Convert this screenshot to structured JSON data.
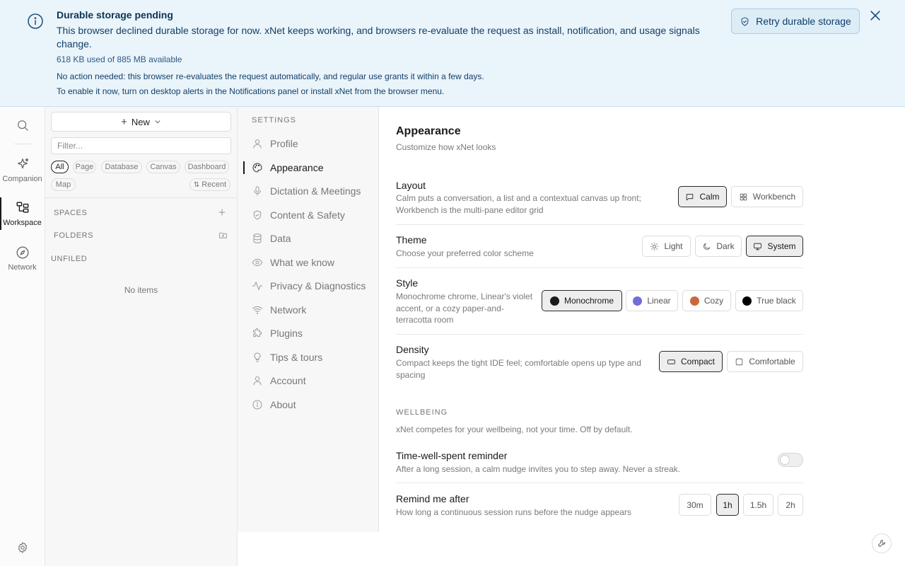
{
  "banner": {
    "title": "Durable storage pending",
    "body": "This browser declined durable storage for now. xNet keeps working, and browsers re-evaluate the request as install, notification, and usage signals change.",
    "usage": "618 KB used of 885 MB available",
    "note1": "No action needed: this browser re-evaluates the request automatically, and regular use grants it within a few days.",
    "note2": "To enable it now, turn on desktop alerts in the Notifications panel or install xNet from the browser menu.",
    "retry_label": "Retry durable storage",
    "icon": "info-icon"
  },
  "rail": {
    "items": [
      {
        "label": "Companion",
        "icon": "sparkle-icon"
      },
      {
        "label": "Workspace",
        "icon": "workspace-icon"
      },
      {
        "label": "Network",
        "icon": "compass-icon"
      }
    ]
  },
  "sidebar": {
    "new_label": "New",
    "filter_placeholder": "Filter...",
    "chips": [
      "All",
      "Page",
      "Database",
      "Canvas",
      "Dashboard",
      "Map"
    ],
    "active_chip": "All",
    "recent_label": "Recent",
    "spaces_label": "SPACES",
    "folders_label": "FOLDERS",
    "unfiled_label": "UNFILED",
    "empty_label": "No items"
  },
  "settings_nav": {
    "heading": "SETTINGS",
    "items": [
      {
        "label": "Profile",
        "icon": "user-icon"
      },
      {
        "label": "Appearance",
        "icon": "palette-icon"
      },
      {
        "label": "Dictation & Meetings",
        "icon": "mic-icon"
      },
      {
        "label": "Content & Safety",
        "icon": "shield-icon"
      },
      {
        "label": "Data",
        "icon": "database-icon"
      },
      {
        "label": "What we know",
        "icon": "eye-icon"
      },
      {
        "label": "Privacy & Diagnostics",
        "icon": "activity-icon"
      },
      {
        "label": "Network",
        "icon": "wifi-icon"
      },
      {
        "label": "Plugins",
        "icon": "puzzle-icon"
      },
      {
        "label": "Tips & tours",
        "icon": "lightbulb-icon"
      },
      {
        "label": "Account",
        "icon": "user-icon"
      },
      {
        "label": "About",
        "icon": "info-icon"
      }
    ],
    "active": "Appearance"
  },
  "appearance": {
    "title": "Appearance",
    "subtitle": "Customize how xNet looks",
    "layout": {
      "title": "Layout",
      "desc": "Calm puts a conversation, a list and a contextual canvas up front; Workbench is the multi-pane editor grid",
      "options": [
        "Calm",
        "Workbench"
      ],
      "selected": "Calm"
    },
    "theme": {
      "title": "Theme",
      "desc": "Choose your preferred color scheme",
      "options": [
        "Light",
        "Dark",
        "System"
      ],
      "selected": "System"
    },
    "style": {
      "title": "Style",
      "desc": "Monochrome chrome, Linear's violet accent, or a cozy paper-and-terracotta room",
      "options": [
        "Monochrome",
        "Linear",
        "Cozy",
        "True black"
      ],
      "colors": [
        "#1a1a1a",
        "#6e6fd8",
        "#c8693c",
        "#000000"
      ],
      "selected": "Monochrome"
    },
    "density": {
      "title": "Density",
      "desc": "Compact keeps the tight IDE feel; comfortable opens up type and spacing",
      "options": [
        "Compact",
        "Comfortable"
      ],
      "selected": "Compact"
    }
  },
  "wellbeing": {
    "heading": "WELLBEING",
    "subtitle": "xNet competes for your wellbeing, not your time. Off by default.",
    "reminder": {
      "title": "Time-well-spent reminder",
      "desc": "After a long session, a calm nudge invites you to step away. Never a streak.",
      "enabled": false
    },
    "remind_after": {
      "title": "Remind me after",
      "desc": "How long a continuous session runs before the nudge appears",
      "options": [
        "30m",
        "1h",
        "1.5h",
        "2h"
      ],
      "selected": "1h"
    }
  }
}
